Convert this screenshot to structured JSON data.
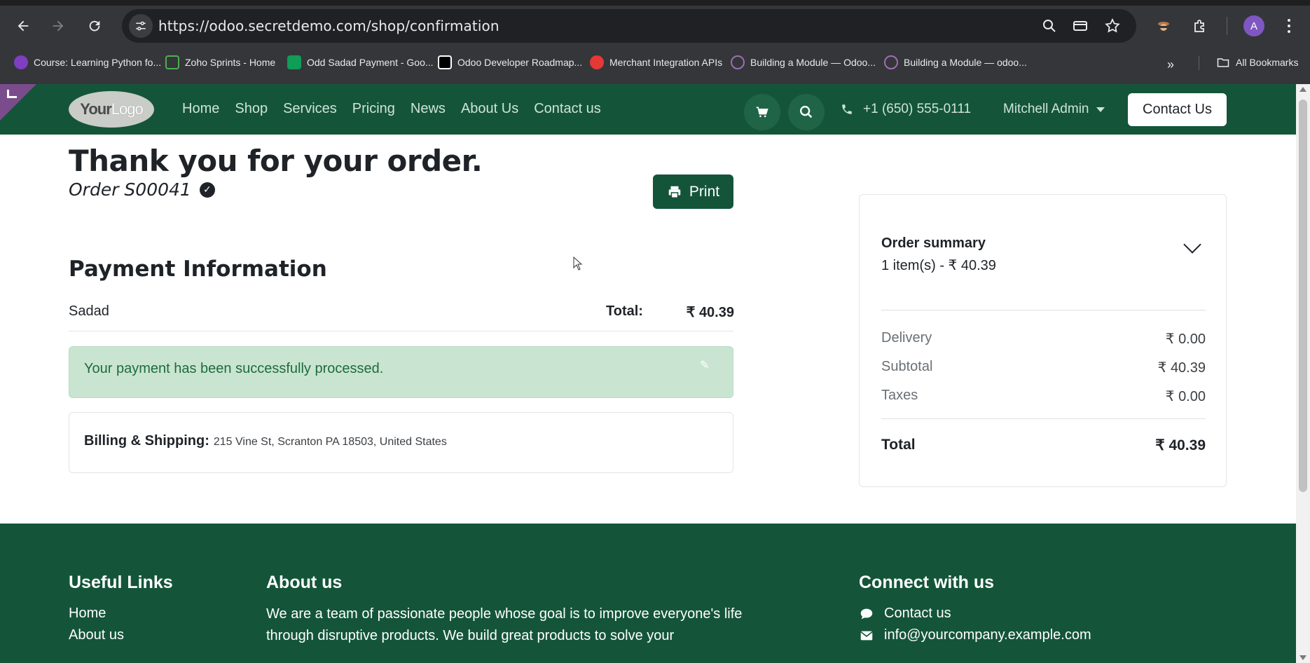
{
  "browser": {
    "url": "https://odoo.secretdemo.com/shop/confirmation",
    "avatar_letter": "A",
    "bookmarks": [
      {
        "label": "Course: Learning Python fo...",
        "color": "#7e3fc0"
      },
      {
        "label": "Zoho Sprints - Home",
        "color": "#2e7d32"
      },
      {
        "label": "Odd Sadad Payment - Goo...",
        "color": "#0f9d58"
      },
      {
        "label": "Odoo Developer Roadmap...",
        "color": "#000000"
      },
      {
        "label": "Merchant Integration APIs",
        "color": "#e53935"
      },
      {
        "label": "Building a Module — Odoo...",
        "color": "#7b4c8c"
      },
      {
        "label": "Building a Module — odoo...",
        "color": "#7b4c8c"
      }
    ],
    "all_bookmarks": "All Bookmarks"
  },
  "header": {
    "logo_part1": "Your",
    "logo_part2": "Logo",
    "nav": [
      "Home",
      "Shop",
      "Services",
      "Pricing",
      "News",
      "About Us",
      "Contact us"
    ],
    "phone": "+1 (650) 555-0111",
    "user": "Mitchell Admin",
    "contact_button": "Contact Us"
  },
  "order": {
    "title": "Thank you for your order.",
    "order_ref": "Order S00041",
    "print_label": "Print",
    "payment_heading": "Payment Information",
    "payment_method": "Sadad",
    "total_label": "Total:",
    "total_value": "₹ 40.39",
    "alert_text": "Your payment has been successfully processed.",
    "billing_label": "Billing & Shipping:",
    "billing_address": "215 Vine St, Scranton PA 18503, United States"
  },
  "summary": {
    "title": "Order summary",
    "subtitle": "1 item(s) -  ₹ 40.39",
    "rows": [
      {
        "label": "Delivery",
        "value": "₹ 0.00"
      },
      {
        "label": "Subtotal",
        "value": "₹ 40.39"
      },
      {
        "label": "Taxes",
        "value": "₹ 0.00"
      }
    ],
    "total_label": "Total",
    "total_value": "₹ 40.39"
  },
  "footer": {
    "useful_links_heading": "Useful Links",
    "links": [
      "Home",
      "About us"
    ],
    "about_heading": "About us",
    "about_text": "We are a team of passionate people whose goal is to improve everyone's life through disruptive products. We build great products to solve your",
    "connect_heading": "Connect with us",
    "contact_link": "Contact us",
    "email": "info@yourcompany.example.com"
  },
  "colors": {
    "brand_green": "#14553a",
    "alert_bg": "#c9e5d1",
    "alert_text": "#1e6b3b"
  }
}
